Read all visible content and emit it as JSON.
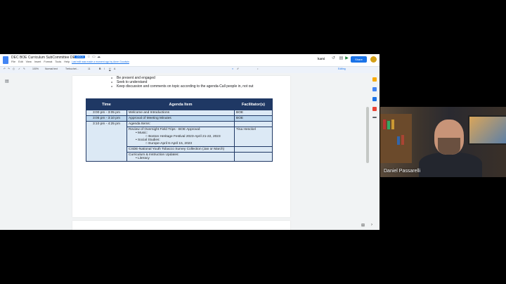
{
  "window": {
    "doc_title": "DEC BOE Curriculum SubCommittee DEC...",
    "badge": ".DOCX",
    "menus": [
      "File",
      "Edit",
      "View",
      "Insert",
      "Format",
      "Tools",
      "Help"
    ],
    "last_edit": "Last edit was made a moment ago by Anne Goodwin",
    "kami": "kami",
    "share_label": "Share",
    "editing_label": "Editing"
  },
  "toolbar": {
    "zoom": "100%",
    "style": "Normal text",
    "font": "Trebuchet...",
    "font_size": "11"
  },
  "document": {
    "bullets": [
      "Be present and engaged",
      "Seek to understand",
      "Keep discussion and comments on topic according to the agenda-Call people in, not out"
    ],
    "table": {
      "headers": [
        "Time",
        "Agenda Item",
        "Facilitator(s)"
      ],
      "rows": [
        {
          "time": "3:00 pm - 3:05 pm",
          "item": "Welcome and Introductions",
          "facilitator": "BOE"
        },
        {
          "time": "3:05 pm - 3:10 pm",
          "item": "Approval of Meeting Minutes",
          "facilitator": "BOE"
        },
        {
          "time": "3:10 pm - 4:25 pm",
          "item": "Agenda Items:",
          "facilitator": ""
        }
      ],
      "field_trips": {
        "title": "Review of Overnight Field Trips - BOE Approval:",
        "music_label": "Music:",
        "music_item": "Boston Heritage Festival 2023-April 21-22, 2023",
        "social_label": "Social Studies:",
        "social_item": "Europe-April 6-April 15, 2023",
        "facilitator": "Tina Henckel"
      },
      "csde": "CSDE-National Youth Tobacco Survey Collection (Jan or March)",
      "curriculum": {
        "title": "Curriculum & Instruction Updates:",
        "item": "Literacy"
      }
    }
  },
  "webcam": {
    "name": "Daniel Passarelli"
  }
}
